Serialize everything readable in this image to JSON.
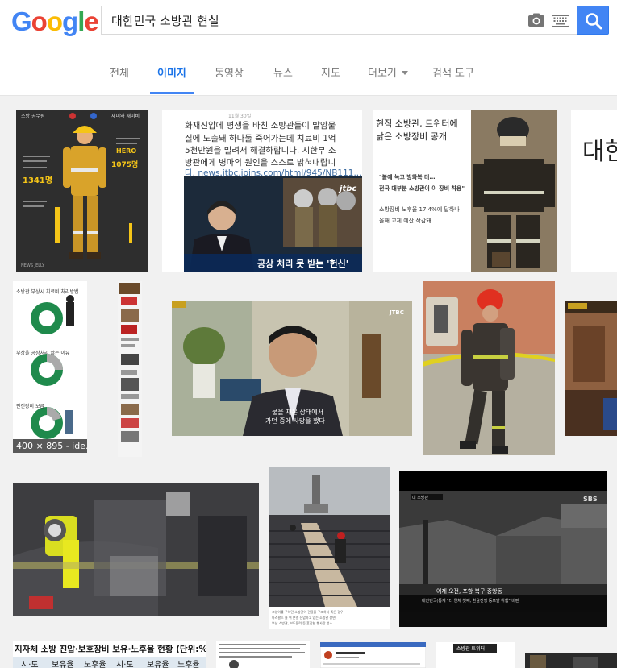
{
  "header": {
    "logo_letters": [
      {
        "ch": "G",
        "color": "#4285f4"
      },
      {
        "ch": "o",
        "color": "#ea4335"
      },
      {
        "ch": "o",
        "color": "#fbbc05"
      },
      {
        "ch": "g",
        "color": "#4285f4"
      },
      {
        "ch": "l",
        "color": "#34a853"
      },
      {
        "ch": "e",
        "color": "#ea4335"
      }
    ],
    "search_value": "대한민국 소방관 현실",
    "search_button_color": "#4285f4"
  },
  "tabs": {
    "all": "전체",
    "images": "이미지",
    "videos": "동영상",
    "news": "뉴스",
    "maps": "지도",
    "more": "더보기",
    "search_tools": "검색 도구"
  },
  "results": {
    "thumb1": {
      "title": "소방 공무원",
      "title_right": "재미와 재미비",
      "hero": "HERO",
      "num_left": "1341명",
      "num_right": "1075명",
      "sign": "NEWS JELLY"
    },
    "thumb2": {
      "lines": [
        "화재진압에 평생을 바친 소방관들이 발암물",
        "질에 노출돼 하나둘 죽어가는데 치료비 1억",
        "5천만원을 빌려서 해결하랍니다. 시한부 소",
        "방관에게 병마의 원인을 스스로 밝혀내랍니",
        "다. news.jtbc.joins.com/html/945/NB111..."
      ],
      "corner": "11월 30일",
      "caption": "공상 처리 못 받는 '헌신'",
      "logo": "jtbc"
    },
    "thumb3": {
      "title_lines": [
        "현직 소방관, 트위터에",
        "낡은 소방장비 공개"
      ],
      "body_lines": [
        "\"불에 녹고 방화복 터…",
        "전국 대부분 소방관이 이 장비 착용\"",
        "소방장비 노후율 17.4%에 달하나",
        "올해 교체 예산 삭감돼"
      ]
    },
    "thumb4": {
      "text": "대한"
    },
    "thumb5": {
      "title": "소방관 부상시 치료비 처리방법",
      "mid": "부상을 공상처리 않는 이유",
      "bottom": "안전장비 보급",
      "dims": "400 × 895 - ide..."
    },
    "thumb7": {
      "logo": "JTBC",
      "subtitle_lines": [
        "물을 채운 상태에서",
        "가던 중에 사망을 했다"
      ]
    },
    "thumb11": {
      "lines": [
        "고양이를 구하던 소방관이 건물을 구조하다 죽은 경우",
        "아스팔트 물 위 분열 진압하고 있는 소방관 장면",
        "부산 소방관, 보도블럭 등 혼잡한 행사장 청소"
      ]
    },
    "thumb12": {
      "logo": "SBS",
      "badge": "내 소방관",
      "caption_main": "어제 오전, 포항 복구 중앙동",
      "caption_sub": "대한민국(통계 \"더 연차 첫째, 환율전쟁 동포발 위험\" 비판"
    },
    "thumb13": {
      "title": "지자체 소방 진압·보호장비 보유·노후율 현황 (단위:%)",
      "cols": [
        "시·도",
        "보유율",
        "노후율",
        "시·도",
        "보유율",
        "노후율"
      ]
    },
    "thumb16": {
      "text": "소방관 트위터"
    }
  }
}
